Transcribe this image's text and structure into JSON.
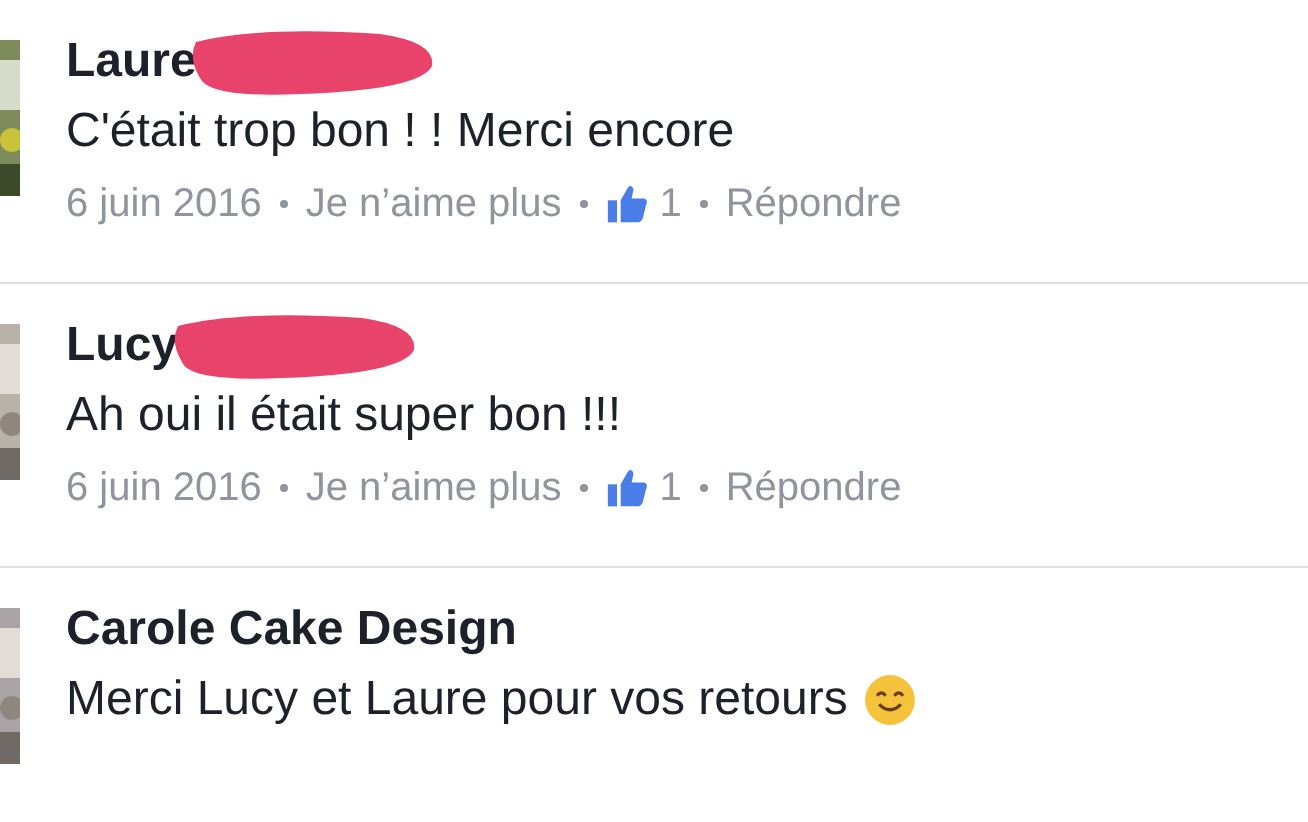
{
  "comments": [
    {
      "author": "Laure",
      "redacted": true,
      "text": "C'était trop bon ! ! Merci encore",
      "meta": {
        "date": "6 juin 2016",
        "action": "Je n’aime plus",
        "likes": "1",
        "reply": "Répondre"
      }
    },
    {
      "author": "Lucy",
      "redacted": true,
      "text": "Ah oui il était super bon !!!",
      "meta": {
        "date": "6 juin 2016",
        "action": "Je n’aime plus",
        "likes": "1",
        "reply": "Répondre"
      }
    },
    {
      "author": "Carole Cake Design",
      "text": "Merci Lucy et Laure pour vos retours",
      "emoji": true
    }
  ]
}
